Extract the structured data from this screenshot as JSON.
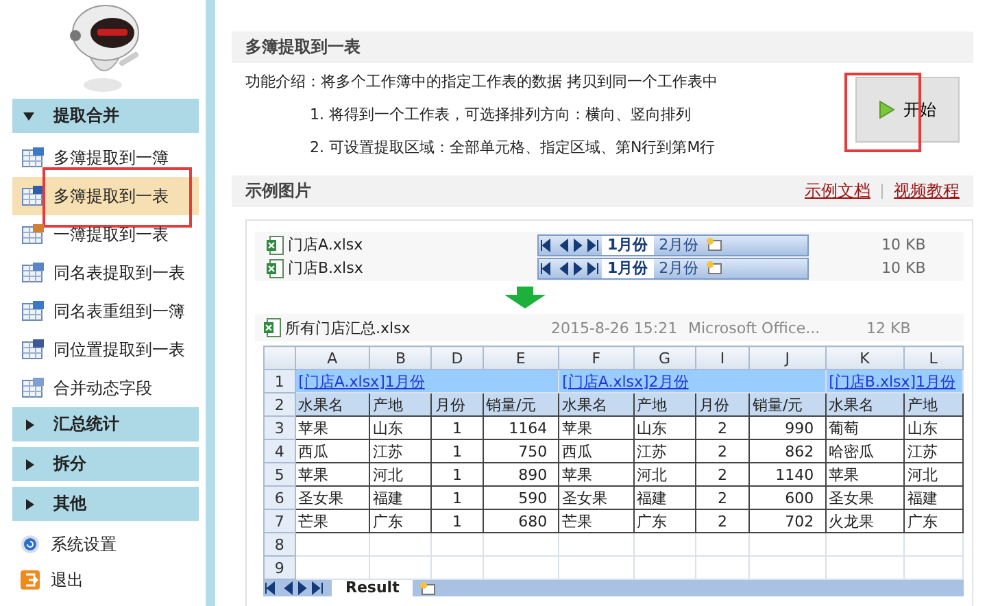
{
  "sidebar": {
    "sections": [
      {
        "label": "提取合并",
        "expanded": true,
        "items": [
          {
            "label": "多簿提取到一簿",
            "selected": false,
            "highlighted": false
          },
          {
            "label": "多簿提取到一表",
            "selected": true,
            "highlighted": true
          },
          {
            "label": "一簿提取到一表",
            "selected": false,
            "highlighted": false
          },
          {
            "label": "同名表提取到一表",
            "selected": false,
            "highlighted": false
          },
          {
            "label": "同名表重组到一簿",
            "selected": false,
            "highlighted": false
          },
          {
            "label": "同位置提取到一表",
            "selected": false,
            "highlighted": false
          },
          {
            "label": "合并动态字段",
            "selected": false,
            "highlighted": false
          }
        ]
      },
      {
        "label": "汇总统计",
        "expanded": false
      },
      {
        "label": "拆分",
        "expanded": false
      },
      {
        "label": "其他",
        "expanded": false
      }
    ],
    "footer_items": [
      {
        "label": "系统设置",
        "kind": "settings"
      },
      {
        "label": "退出",
        "kind": "exit"
      }
    ]
  },
  "main": {
    "title": "多簿提取到一表",
    "intro": "功能介绍：将多个工作簿中的指定工作表的数据 拷贝到同一个工作表中",
    "steps": [
      "1. 将得到一个工作表，可选择排列方向：横向、竖向排列",
      "2. 可设置提取区域：全部单元格、指定区域、第N行到第M行"
    ],
    "start_button": {
      "label": "开始",
      "highlighted": true
    },
    "example_title": "示例图片",
    "links": [
      "示例文档",
      "视频教程"
    ],
    "example_files": [
      {
        "name": "门店A.xlsx",
        "size": "10 KB",
        "tabs": [
          {
            "label": "1月份",
            "selected": true
          },
          {
            "label": "2月份",
            "selected": false
          }
        ]
      },
      {
        "name": "门店B.xlsx",
        "size": "10 KB",
        "tabs": [
          {
            "label": "1月份",
            "selected": true
          },
          {
            "label": "2月份",
            "selected": false
          }
        ]
      }
    ],
    "result_file": {
      "name": "所有门店汇总.xlsx",
      "date": "2015-8-26 15:21",
      "type": "Microsoft Office...",
      "size": "12 KB"
    },
    "sheet": {
      "columns": [
        {
          "label": "A",
          "kind": "text"
        },
        {
          "label": "B",
          "kind": "text"
        },
        {
          "label": "D",
          "kind": "center"
        },
        {
          "label": "E",
          "kind": "number"
        },
        {
          "label": "F",
          "kind": "text"
        },
        {
          "label": "G",
          "kind": "text"
        },
        {
          "label": "I",
          "kind": "center"
        },
        {
          "label": "J",
          "kind": "number"
        },
        {
          "label": "K",
          "kind": "text"
        },
        {
          "label": "L",
          "kind": "text"
        }
      ],
      "title_row": {
        "number": "1",
        "groups": [
          {
            "text": "[门店A.xlsx]1月份"
          },
          {
            "text": "[门店A.xlsx]2月份"
          },
          {
            "text": "[门店B.xlsx]1月份"
          }
        ]
      },
      "header_row": {
        "number": "2",
        "cells": [
          "水果名",
          "产地",
          "月份",
          "销量/元",
          "水果名",
          "产地",
          "月份",
          "销量/元",
          "水果名",
          "产地"
        ]
      },
      "rows": [
        {
          "number": "3",
          "cells": [
            "苹果",
            "山东",
            "1",
            "1164",
            "苹果",
            "山东",
            "2",
            "990",
            "葡萄",
            "山东"
          ]
        },
        {
          "number": "4",
          "cells": [
            "西瓜",
            "江苏",
            "1",
            "750",
            "西瓜",
            "江苏",
            "2",
            "862",
            "哈密瓜",
            "江苏"
          ]
        },
        {
          "number": "5",
          "cells": [
            "苹果",
            "河北",
            "1",
            "890",
            "苹果",
            "河北",
            "2",
            "1140",
            "苹果",
            "河北"
          ]
        },
        {
          "number": "6",
          "cells": [
            "圣女果",
            "福建",
            "1",
            "590",
            "圣女果",
            "福建",
            "2",
            "600",
            "圣女果",
            "福建"
          ]
        },
        {
          "number": "7",
          "cells": [
            "芒果",
            "广东",
            "1",
            "680",
            "芒果",
            "广东",
            "2",
            "702",
            "火龙果",
            "广东"
          ]
        }
      ],
      "empty_rows": [
        "8",
        "9"
      ],
      "tabs": [
        {
          "label": "Result",
          "selected": true
        }
      ]
    }
  }
}
